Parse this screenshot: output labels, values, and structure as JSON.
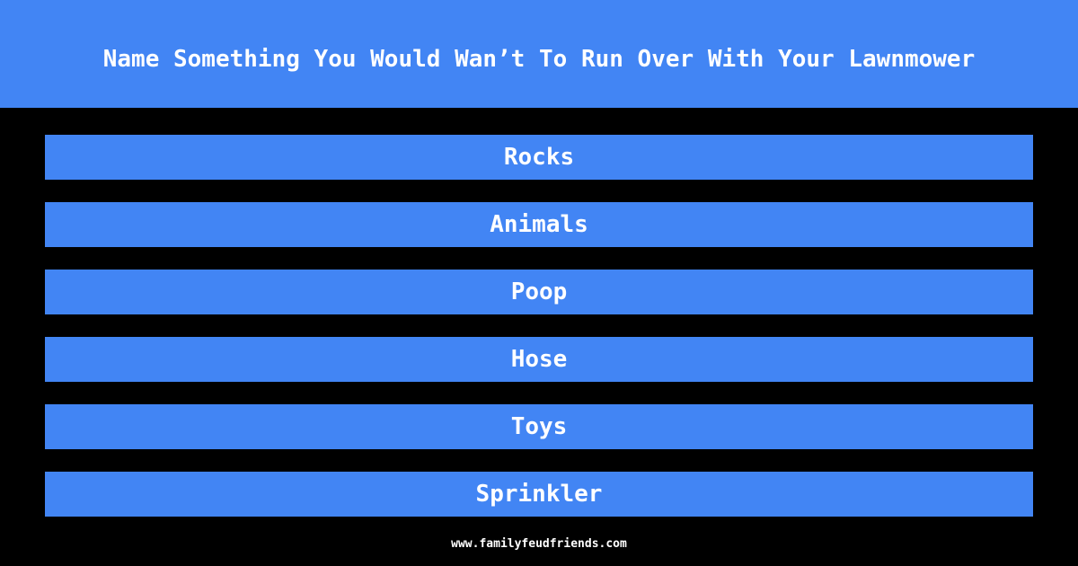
{
  "question": "Name Something You Would Wan’t To Run Over With Your Lawnmower",
  "answers": [
    "Rocks",
    "Animals",
    "Poop",
    "Hose",
    "Toys",
    "Sprinkler"
  ],
  "footer": "www.familyfeudfriends.com",
  "colors": {
    "accent": "#4285f4",
    "background": "#000000",
    "text": "#ffffff"
  }
}
